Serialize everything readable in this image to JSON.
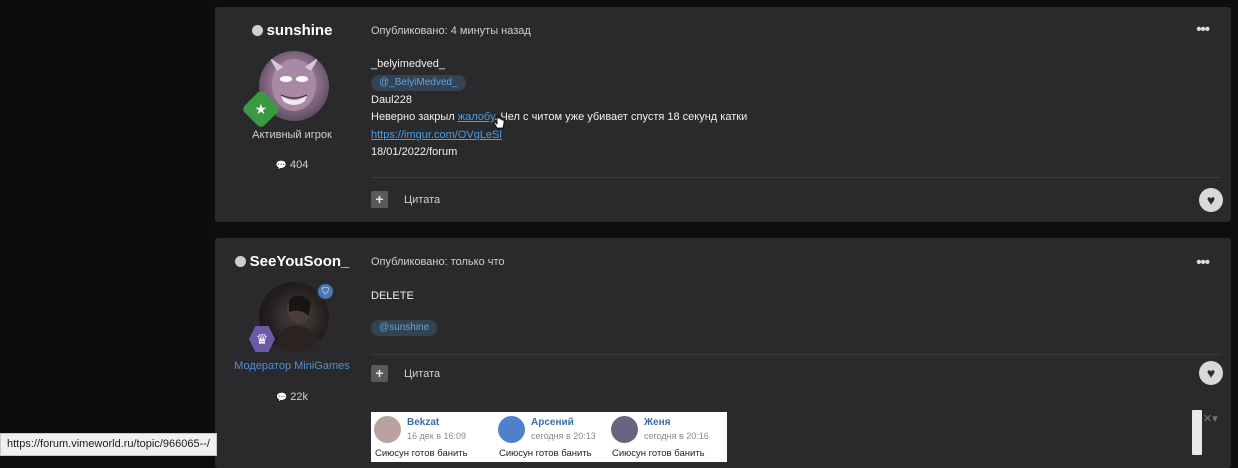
{
  "posts": [
    {
      "author": "sunshine",
      "role": "Активный игрок",
      "post_count": "404",
      "posted": "Опубликовано: 4 минуты назад",
      "lines": {
        "quoted_user": "_belyimedved_",
        "mention": "@_BelyiMedved_",
        "player": "Daul228",
        "text_before": "Неверно закрыл ",
        "link_word": "жалобу",
        "text_after": ". Чел с читом уже убивает спустя 18 секунд катки",
        "url": "https://imgur.com/OVqLeSl",
        "date": "18/01/2022/forum"
      },
      "quote_label": "Цитата"
    },
    {
      "author": "SeeYouSoon_",
      "role": "Модератор MiniGames",
      "post_count": "22k",
      "posted": "Опубликовано: только что",
      "text": "DELETE",
      "mention": "@sunshine",
      "quote_label": "Цитата",
      "embed_comments": [
        {
          "name": "Bekzat",
          "time": "16 дек в 16:09",
          "text": "Сиюсун готов банить",
          "avatar_color": "#b9a3a0"
        },
        {
          "name": "Арсений",
          "time": "сегодня в 20:13",
          "text": "Сиюсун готов банить",
          "avatar_color": "#4f7fcf"
        },
        {
          "name": "Женя",
          "time": "сегодня в 20:16",
          "text": "Сиюсун готов банить",
          "avatar_color": "#6b6480"
        }
      ]
    }
  ],
  "icons": {
    "menu": "•••",
    "plus": "+",
    "heart": "♥",
    "comments": "💬"
  },
  "status_url": "https://forum.vimeworld.ru/topic/966065--/"
}
